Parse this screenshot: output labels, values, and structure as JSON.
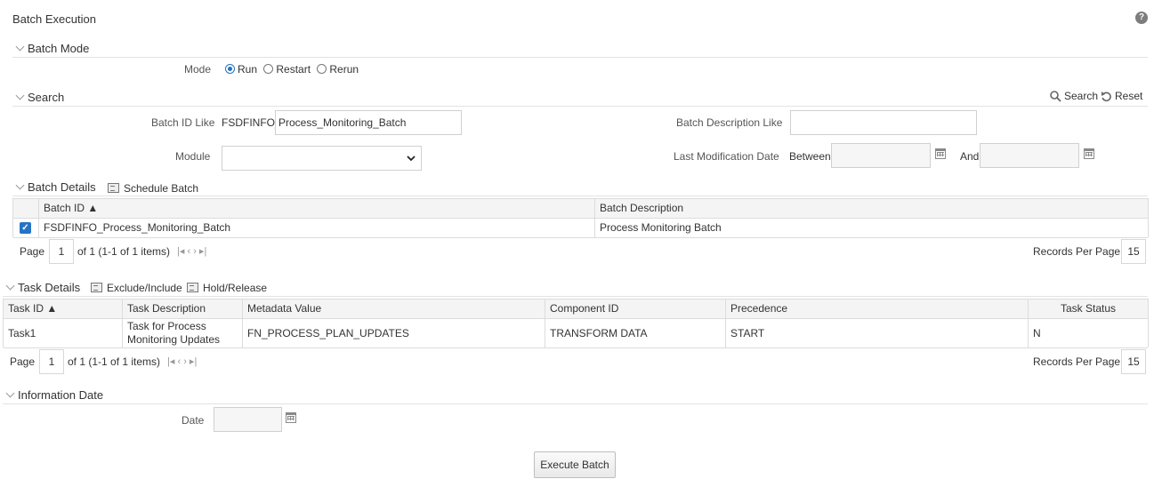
{
  "page": {
    "title": "Batch Execution"
  },
  "batch_mode": {
    "header": "Batch Mode",
    "mode_label": "Mode",
    "options": [
      "Run",
      "Restart",
      "Rerun"
    ],
    "selected": "Run"
  },
  "search": {
    "header": "Search",
    "search_label": "Search",
    "reset_label": "Reset",
    "batch_id_label": "Batch ID Like",
    "batch_id_prefix": "FSDFINFO_",
    "batch_id_value": "Process_Monitoring_Batch",
    "batch_desc_label": "Batch Description Like",
    "batch_desc_value": "",
    "module_label": "Module",
    "module_value": "",
    "last_mod_label": "Last Modification Date",
    "between_label": "Between",
    "and_label": "And"
  },
  "batch_details": {
    "header": "Batch Details",
    "schedule_label": "Schedule Batch",
    "columns": [
      "Batch ID ▲",
      "Batch Description"
    ],
    "rows": [
      {
        "checked": true,
        "batch_id": "FSDFINFO_Process_Monitoring_Batch",
        "description": "Process Monitoring Batch"
      }
    ],
    "pager": {
      "page_label": "Page",
      "page": "1",
      "of_text": "of 1 (1-1 of 1 items)",
      "records_label": "Records Per Page",
      "records": "15"
    }
  },
  "task_details": {
    "header": "Task Details",
    "exclude_label": "Exclude/Include",
    "hold_label": "Hold/Release",
    "columns": [
      "Task ID ▲",
      "Task Description",
      "Metadata Value",
      "Component ID",
      "Precedence",
      "Task Status"
    ],
    "rows": [
      {
        "task_id": "Task1",
        "description": "Task for Process Monitoring Updates",
        "metadata": "FN_PROCESS_PLAN_UPDATES",
        "component": "TRANSFORM DATA",
        "precedence": "START",
        "status": "N"
      }
    ],
    "pager": {
      "page_label": "Page",
      "page": "1",
      "of_text": "of 1 (1-1 of 1 items)",
      "records_label": "Records Per Page",
      "records": "15"
    }
  },
  "information_date": {
    "header": "Information Date",
    "date_label": "Date",
    "date_value": ""
  },
  "footer": {
    "execute_label": "Execute Batch"
  },
  "icons": {
    "help": "help-icon",
    "search": "search-icon",
    "reset": "reset-icon",
    "calendar": "calendar-icon",
    "schedule": "schedule-icon",
    "exclude": "exclude-include-icon",
    "hold": "hold-release-icon"
  },
  "colors": {
    "accent": "#2673c5",
    "header_bg": "#f4f4f4",
    "border": "#dcdcdc"
  }
}
